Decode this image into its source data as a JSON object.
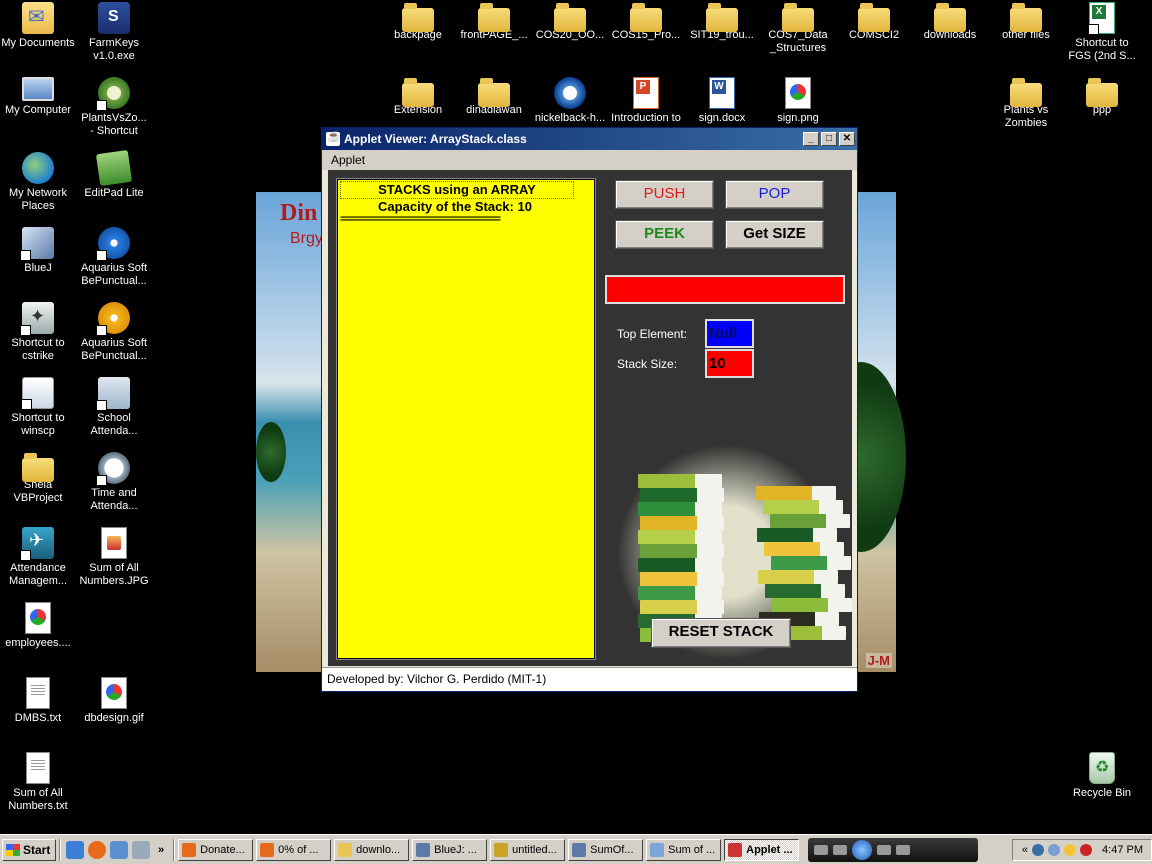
{
  "desktop": {
    "icons": [
      {
        "id": "my-documents",
        "label": "My Documents",
        "glyph": "g-mydocs"
      },
      {
        "id": "farmkeys",
        "label": "FarmKeys\nv1.0.exe",
        "glyph": "g-app"
      },
      {
        "id": "my-computer",
        "label": "My Computer",
        "glyph": "g-computer"
      },
      {
        "id": "plantsvszombies-shortcut",
        "label": "PlantsVsZo...\n- Shortcut",
        "glyph": "g-plant"
      },
      {
        "id": "my-network-places",
        "label": "My Network\nPlaces",
        "glyph": "g-network"
      },
      {
        "id": "editpad-lite",
        "label": "EditPad Lite",
        "glyph": "g-edit"
      },
      {
        "id": "bluej",
        "label": "BlueJ",
        "glyph": "g-bluej"
      },
      {
        "id": "aquarius-1",
        "label": "Aquarius Soft\nBePunctual...",
        "glyph": "g-disc"
      },
      {
        "id": "cstrike",
        "label": "Shortcut to\ncstrike",
        "glyph": "g-cs"
      },
      {
        "id": "aquarius-2",
        "label": "Aquarius Soft\nBePunctual...",
        "glyph": "g-disc2"
      },
      {
        "id": "winscp",
        "label": "Shortcut to\nwinscp",
        "glyph": "g-winscp"
      },
      {
        "id": "school-attendance",
        "label": "School\nAttenda...",
        "glyph": "g-school"
      },
      {
        "id": "shela-vbproject",
        "label": "Shela\nVBProject",
        "glyph": "g-folder"
      },
      {
        "id": "time-attendance",
        "label": "Time and\nAttenda...",
        "glyph": "g-clock"
      },
      {
        "id": "attendance-mgmt",
        "label": "Attendance\nManagem...",
        "glyph": "g-attend"
      },
      {
        "id": "sum-all-jpg",
        "label": "Sum of All\nNumbers.JPG",
        "glyph": "g-sum"
      },
      {
        "id": "employees",
        "label": "employees....",
        "glyph": "g-img"
      },
      {
        "id": "dmbs-txt",
        "label": "DMBS.txt",
        "glyph": "g-doc"
      },
      {
        "id": "dbdesign",
        "label": "dbdesign.gif",
        "glyph": "g-img"
      },
      {
        "id": "sum-all-txt",
        "label": "Sum of All\nNumbers.txt",
        "glyph": "g-doc"
      },
      {
        "id": "backpage",
        "label": "backpage",
        "glyph": "g-folder"
      },
      {
        "id": "frontpage",
        "label": "frontPAGE_...",
        "glyph": "g-folder"
      },
      {
        "id": "cos20",
        "label": "COS20_OO...",
        "glyph": "g-folder"
      },
      {
        "id": "cos15",
        "label": "COS15_Pro...",
        "glyph": "g-folder"
      },
      {
        "id": "sit19",
        "label": "SIT19_trou...",
        "glyph": "g-folder"
      },
      {
        "id": "cos7",
        "label": "COS7_Data\n_Structures",
        "glyph": "g-folder"
      },
      {
        "id": "comsci2",
        "label": "COMSCI2",
        "glyph": "g-folder"
      },
      {
        "id": "downloads",
        "label": "downloads",
        "glyph": "g-folder"
      },
      {
        "id": "other-files",
        "label": "other files",
        "glyph": "g-folder"
      },
      {
        "id": "fgs-shortcut",
        "label": "Shortcut to\nFGS (2nd S...",
        "glyph": "g-xls"
      },
      {
        "id": "extension",
        "label": "Extension",
        "glyph": "g-folder"
      },
      {
        "id": "dinadiawan",
        "label": "dinadiawan",
        "glyph": "g-folder"
      },
      {
        "id": "nickelback",
        "label": "nickelback-h...",
        "glyph": "g-media"
      },
      {
        "id": "introduction",
        "label": "Introduction to",
        "glyph": "g-ppt"
      },
      {
        "id": "sign-docx",
        "label": "sign.docx",
        "glyph": "g-word"
      },
      {
        "id": "sign-png",
        "label": "sign.png",
        "glyph": "g-img"
      },
      {
        "id": "plants-vs-zombies",
        "label": "Plants vs\nZombies",
        "glyph": "g-folder"
      },
      {
        "id": "ppp",
        "label": "ppp",
        "glyph": "g-folder"
      },
      {
        "id": "recycle-bin",
        "label": "Recycle Bin",
        "glyph": "g-recycle"
      }
    ]
  },
  "wallpaper": {
    "title": "Din",
    "subtitle": "Brgy",
    "corner": "J-M"
  },
  "applet": {
    "title": "Applet Viewer: ArrayStack.class",
    "menu": [
      "Applet"
    ],
    "stack_header": "STACKS using an ARRAY",
    "capacity_line": "Capacity of the Stack: 10",
    "separator": "================================",
    "buttons": {
      "push": "PUSH",
      "pop": "POP",
      "peek": "PEEK",
      "size": "Get SIZE",
      "reset": "RESET STACK"
    },
    "input_value": "",
    "top_element_label": "Top Element:",
    "top_element_value": "Null",
    "stack_size_label": "Stack Size:",
    "stack_size_value": "10",
    "status": "Developed by: Vilchor G. Perdido (MIT-1)",
    "window_controls": {
      "minimize": "_",
      "maximize": "□",
      "close": "✕"
    }
  },
  "taskbar": {
    "start": "Start",
    "overflow": "»",
    "tasks": [
      {
        "label": "Donate...",
        "icon": "firefox-icon",
        "color": "#e66a1a"
      },
      {
        "label": "0% of ...",
        "icon": "firefox-icon",
        "color": "#e66a1a"
      },
      {
        "label": "downlo...",
        "icon": "folder-icon",
        "color": "#e9c556"
      },
      {
        "label": "BlueJ: ...",
        "icon": "bluej-icon",
        "color": "#5b7aa8"
      },
      {
        "label": "untitled...",
        "icon": "paint-icon",
        "color": "#c9a227"
      },
      {
        "label": "SumOf...",
        "icon": "bluej-icon",
        "color": "#5b7aa8"
      },
      {
        "label": "Sum of ...",
        "icon": "notepad-icon",
        "color": "#7aa6d8"
      },
      {
        "label": "Applet ...",
        "icon": "java-icon",
        "color": "#c33",
        "active": true
      }
    ],
    "clock": "4:47 PM",
    "tray_overflow": "«"
  }
}
